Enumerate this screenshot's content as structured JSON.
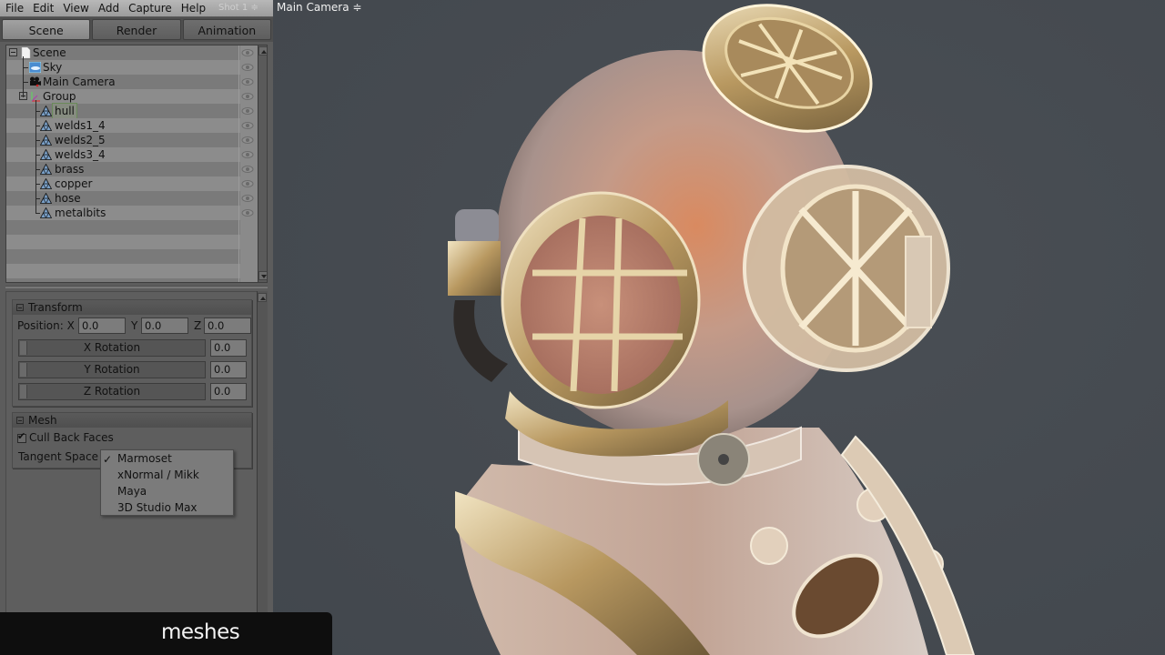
{
  "menubar": {
    "items": [
      "File",
      "Edit",
      "View",
      "Add",
      "Capture",
      "Help"
    ],
    "shot_selector": "Shot 1 ≑"
  },
  "tabs": [
    {
      "label": "Scene",
      "active": true
    },
    {
      "label": "Render",
      "active": false
    },
    {
      "label": "Animation",
      "active": false
    }
  ],
  "scene_tree": {
    "rows": [
      {
        "label": "Scene",
        "icon": "document-icon",
        "depth": 0,
        "expandable": true
      },
      {
        "label": "Sky",
        "icon": "sky-icon",
        "depth": 1
      },
      {
        "label": "Main Camera",
        "icon": "camera-icon",
        "depth": 1
      },
      {
        "label": "Group",
        "icon": "axes-icon",
        "depth": 1,
        "expandable": true
      },
      {
        "label": "hull",
        "icon": "mesh-icon",
        "depth": 2,
        "selected": true
      },
      {
        "label": "welds1_4",
        "icon": "mesh-icon",
        "depth": 2
      },
      {
        "label": "welds2_5",
        "icon": "mesh-icon",
        "depth": 2
      },
      {
        "label": "welds3_4",
        "icon": "mesh-icon",
        "depth": 2
      },
      {
        "label": "brass",
        "icon": "mesh-icon",
        "depth": 2
      },
      {
        "label": "copper",
        "icon": "mesh-icon",
        "depth": 2
      },
      {
        "label": "hose",
        "icon": "mesh-icon",
        "depth": 2
      },
      {
        "label": "metalbits",
        "icon": "mesh-icon",
        "depth": 2
      }
    ]
  },
  "transform": {
    "title": "Transform",
    "position_label": "Position: X",
    "y_label": "Y",
    "z_label": "Z",
    "position": {
      "x": "0.0",
      "y": "0.0",
      "z": "0.0"
    },
    "rotations": [
      {
        "label": "X Rotation",
        "value": "0.0"
      },
      {
        "label": "Y Rotation",
        "value": "0.0"
      },
      {
        "label": "Z Rotation",
        "value": "0.0"
      }
    ]
  },
  "mesh": {
    "title": "Mesh",
    "cull_back_faces_label": "Cull Back Faces",
    "cull_back_faces": true,
    "tangent_space_label": "Tangent Space ≑",
    "tangent_space_options": [
      "Marmoset",
      "xNormal / Mikk",
      "Maya",
      "3D Studio Max"
    ],
    "tangent_space_selected": "Marmoset"
  },
  "viewport": {
    "camera_selector": "Main Camera ≑",
    "background_color": "#454a50"
  },
  "caption": "meshes"
}
